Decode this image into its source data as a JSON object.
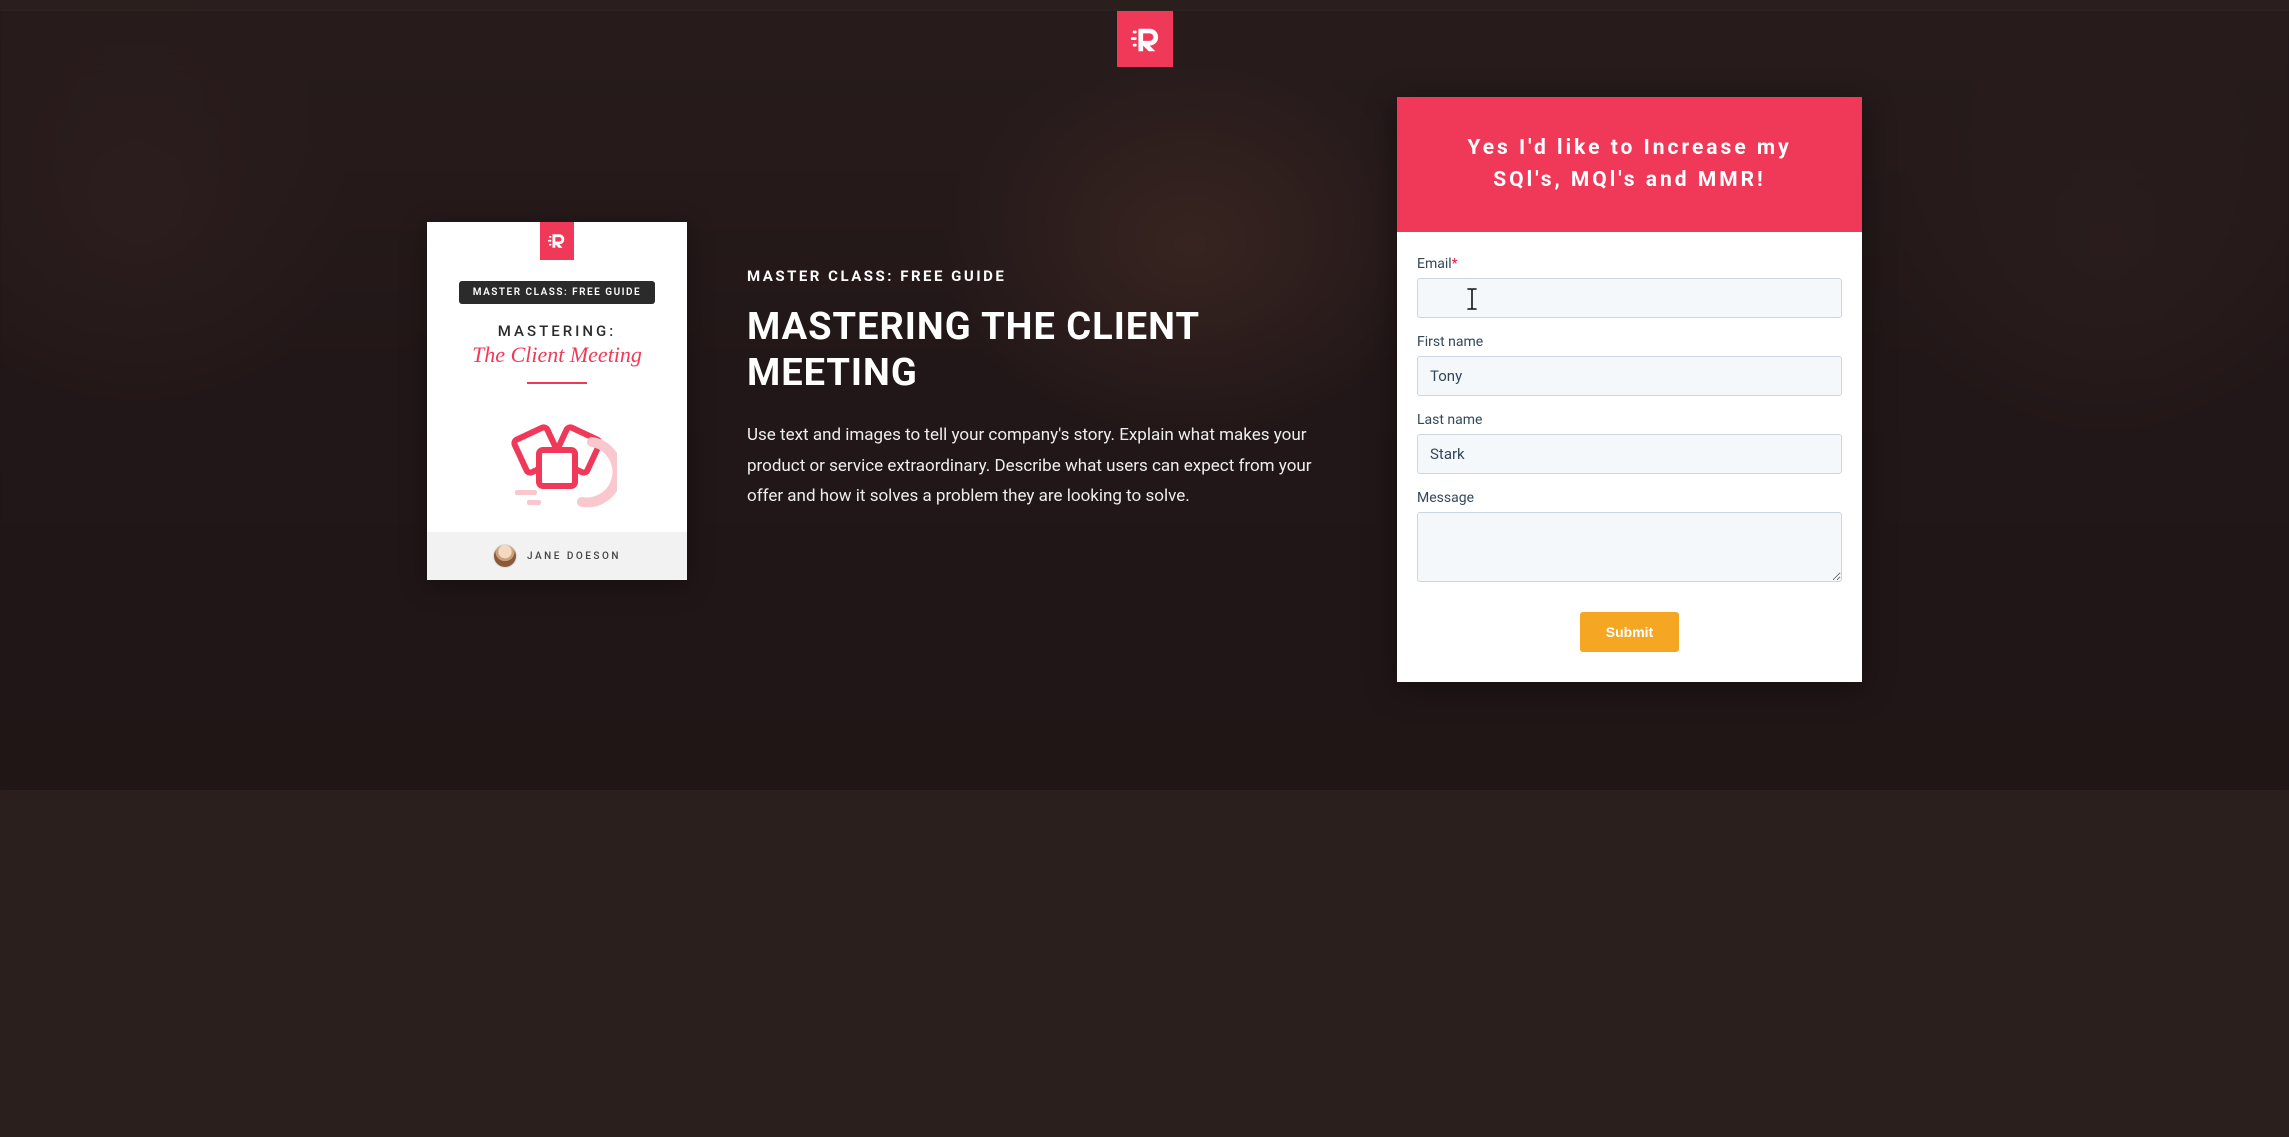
{
  "colors": {
    "accent": "#f03958",
    "submit": "#f5a623"
  },
  "logo": {
    "name": "brand-logo"
  },
  "book": {
    "badge": "MASTER CLASS: FREE GUIDE",
    "title_line1": "MASTERING:",
    "title_line2": "The Client Meeting",
    "author": "JANE DOESON"
  },
  "copy": {
    "eyebrow": "MASTER CLASS: FREE GUIDE",
    "headline": "MASTERING THE CLIENT MEETING",
    "body": "Use text and images to tell your company's story. Explain what makes your product or service extraordinary. Describe what users can expect from your offer and how it solves a problem they are looking to solve."
  },
  "form": {
    "heading": "Yes I'd like to Increase my SQl's, MQl's and MMR!",
    "fields": {
      "email": {
        "label": "Email",
        "required": true,
        "value": ""
      },
      "first_name": {
        "label": "First name",
        "required": false,
        "value": "Tony"
      },
      "last_name": {
        "label": "Last name",
        "required": false,
        "value": "Stark"
      },
      "message": {
        "label": "Message",
        "required": false,
        "value": ""
      }
    },
    "submit_label": "Submit"
  }
}
